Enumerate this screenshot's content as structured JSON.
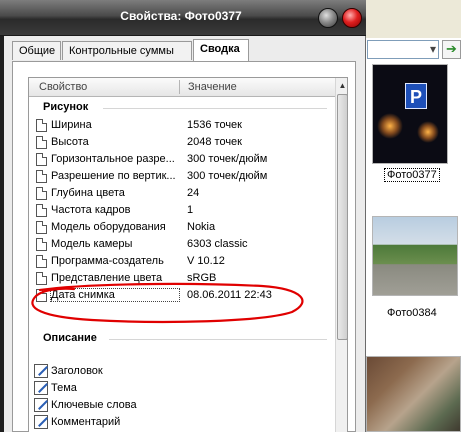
{
  "window": {
    "title": "Свойства: Фото0377"
  },
  "tabs": [
    {
      "label": "Общие",
      "active": false
    },
    {
      "label": "Контрольные суммы",
      "active": false
    },
    {
      "label": "Сводка",
      "active": true
    }
  ],
  "table": {
    "headers": {
      "property": "Свойство",
      "value": "Значение"
    },
    "group_image": "Рисунок",
    "rows": [
      {
        "name": "Ширина",
        "value": "1536 точек"
      },
      {
        "name": "Высота",
        "value": "2048 точек"
      },
      {
        "name": "Горизонтальное разре...",
        "value": "300 точек/дюйм"
      },
      {
        "name": "Разрешение по вертик...",
        "value": "300 точек/дюйм"
      },
      {
        "name": "Глубина цвета",
        "value": "24"
      },
      {
        "name": "Частота кадров",
        "value": "1"
      },
      {
        "name": "Модель оборудования",
        "value": "Nokia"
      },
      {
        "name": "Модель камеры",
        "value": "6303 classic"
      },
      {
        "name": "Программа-создатель",
        "value": "V 10.12"
      },
      {
        "name": "Представление цвета",
        "value": "sRGB"
      },
      {
        "name": "Дата снимка",
        "value": "08.06.2011 22:43"
      }
    ],
    "group_description": "Описание",
    "desc_rows": [
      {
        "name": "Заголовок"
      },
      {
        "name": "Тема"
      },
      {
        "name": "Ключевые слова"
      },
      {
        "name": "Комментарий"
      }
    ]
  },
  "background": {
    "thumbnails": [
      {
        "label": "Фото0377",
        "selected": true
      },
      {
        "label": "Фото0384",
        "selected": false
      },
      {
        "label": "",
        "selected": false
      }
    ],
    "sign_text": "P"
  },
  "colors": {
    "annotation": "#e00000",
    "close_button": "#e02020",
    "sign_blue": "#1d4fb8"
  }
}
